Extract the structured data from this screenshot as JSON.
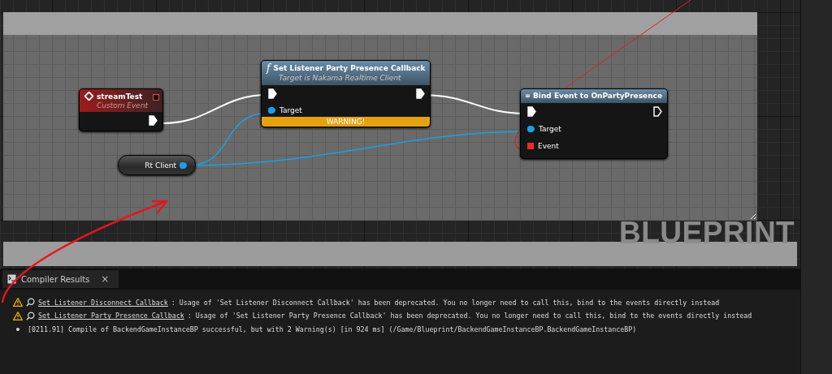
{
  "graph": {
    "watermark": "BLUEPRINT",
    "nodes": [
      {
        "kind": "event",
        "title": "streamTest",
        "subtitle": "Custom Event",
        "exec_out": {
          "connected": true
        }
      },
      {
        "kind": "function",
        "icon": "𝑓",
        "title": "Set Listener Party Presence Callback",
        "subtitle": "Target is Nakama Realtime Client",
        "warning": "WARNING!",
        "exec_in": {
          "connected": true
        },
        "exec_out": {
          "connected": true
        },
        "inputs": [
          {
            "kind": "object",
            "label": "Target"
          }
        ]
      },
      {
        "kind": "bind",
        "title": "Bind Event to OnPartyPresence",
        "exec_in": {
          "connected": true
        },
        "exec_out": {
          "connected": false
        },
        "inputs": [
          {
            "kind": "object",
            "label": "Target"
          },
          {
            "kind": "delegate",
            "label": "Event"
          }
        ]
      },
      {
        "kind": "variable",
        "title": "Rt Client"
      }
    ]
  },
  "compiler_results": {
    "tab": "Compiler Results",
    "close": "×",
    "messages": [
      {
        "kind": "warning",
        "link": "Set Listener Disconnect Callback",
        "text": ": Usage of 'Set Listener Disconnect Callback' has been deprecated. You no longer need to call this, bind to the events directly instead"
      },
      {
        "kind": "warning",
        "link": "Set Listener Party Presence Callback",
        "text": ": Usage of 'Set Listener Party Presence Callback' has been deprecated. You no longer need to call this, bind to the events directly instead"
      },
      {
        "kind": "info",
        "text": "[0211.91] Compile of BackendGameInstanceBP successful, but with 2 Warning(s) [in 924 ms] (/Game/Blueprint/BackendGameInstanceBP.BackendGameInstanceBP)"
      }
    ]
  }
}
